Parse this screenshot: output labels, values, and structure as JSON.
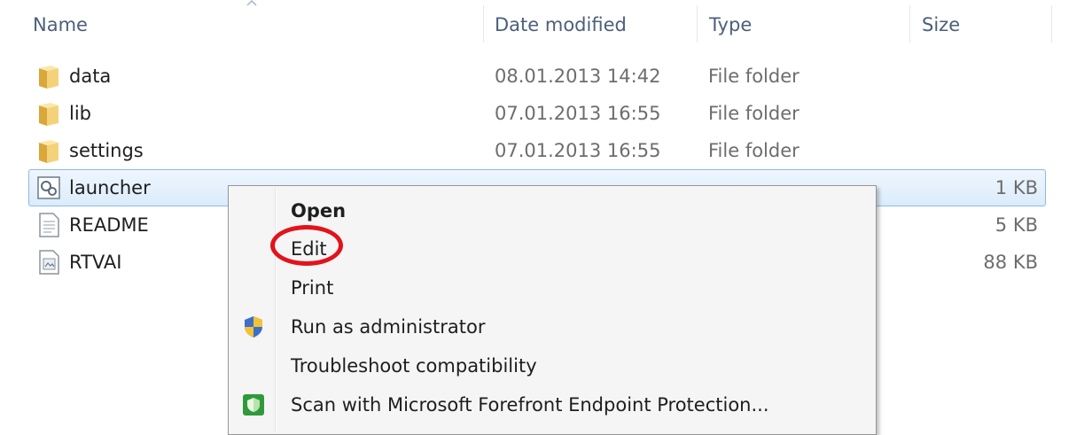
{
  "columns": {
    "name": "Name",
    "date_modified": "Date modified",
    "type": "Type",
    "size": "Size"
  },
  "files": [
    {
      "name": "data",
      "date": "08.01.2013 14:42",
      "type": "File folder",
      "size": "",
      "icon": "folder-icon"
    },
    {
      "name": "lib",
      "date": "07.01.2013 16:55",
      "type": "File folder",
      "size": "",
      "icon": "folder-icon"
    },
    {
      "name": "settings",
      "date": "07.01.2013 16:55",
      "type": "File folder",
      "size": "",
      "icon": "folder-icon"
    },
    {
      "name": "launcher",
      "date": "",
      "type": "",
      "size": "1 KB",
      "icon": "batch-file-icon",
      "selected": true
    },
    {
      "name": "README",
      "date": "",
      "type": "",
      "size": "5 KB",
      "icon": "text-file-icon"
    },
    {
      "name": "RTVAI",
      "date": "",
      "type": "",
      "size": "88 KB",
      "icon": "image-file-icon"
    }
  ],
  "context_menu": {
    "items": [
      {
        "label": "Open",
        "bold": true
      },
      {
        "label": "Edit",
        "highlighted": true
      },
      {
        "label": "Print"
      },
      {
        "label": "Run as administrator",
        "icon": "uac-shield-icon"
      },
      {
        "label": "Troubleshoot compatibility"
      },
      {
        "label": "Scan with Microsoft Forefront Endpoint Protection...",
        "icon": "forefront-shield-icon"
      }
    ]
  },
  "colors": {
    "selection_border": "#8fb8e6",
    "highlight_ring": "#e3131b",
    "header_text": "#4c607a"
  }
}
